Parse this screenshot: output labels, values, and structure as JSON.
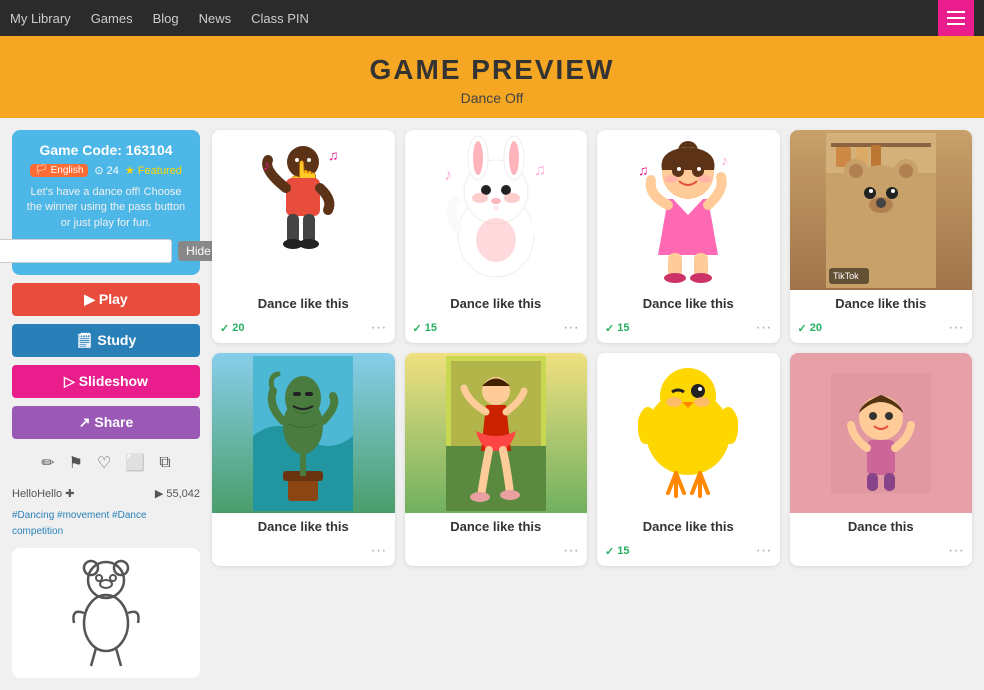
{
  "nav": {
    "items": [
      "My Library",
      "Games",
      "Blog",
      "News",
      "Class PIN"
    ]
  },
  "header": {
    "title": "Game Preview",
    "subtitle": "Dance Off"
  },
  "sidebar": {
    "game_code_label": "Game Code: 163104",
    "badge_english": "🏳 English",
    "badge_count": "⊙ 24",
    "badge_featured": "★ Featured",
    "description": "Let's have a dance off! Choose the winner using the pass button or just play for fun.",
    "hide_placeholder": "",
    "hide_btn": "Hide",
    "play_btn": "▶ Play",
    "study_btn": "🗒 Study",
    "slideshow_btn": "▷ Slideshow",
    "share_btn": "↗ Share",
    "author": "HelloHello ✚",
    "play_count": "55,042",
    "tags": "#Dancing #movement #Dance competition",
    "tools": [
      "✏",
      "⚑",
      "♡",
      "⬜",
      "⧉"
    ]
  },
  "cards": [
    {
      "id": 1,
      "label": "Dance like this",
      "votes": 20,
      "type": "hand-dance"
    },
    {
      "id": 2,
      "label": "Dance like this",
      "votes": 15,
      "type": "bunny"
    },
    {
      "id": 3,
      "label": "Dance like this",
      "votes": 15,
      "type": "baby-girl"
    },
    {
      "id": 4,
      "label": "Dance like this",
      "votes": 20,
      "type": "bear-photo",
      "watermark": "TikTok"
    },
    {
      "id": 5,
      "label": "Dance like this",
      "votes": null,
      "type": "groot"
    },
    {
      "id": 6,
      "label": "Dance like this",
      "votes": null,
      "type": "ballerina"
    },
    {
      "id": 7,
      "label": "Dance like this",
      "votes": 15,
      "type": "chick"
    },
    {
      "id": 8,
      "label": "Dance this",
      "votes": null,
      "type": "child-photo"
    }
  ],
  "colors": {
    "accent": "#e91e8c",
    "play": "#e74c3c",
    "study": "#2980b9",
    "share": "#9b59b6",
    "gamecode": "#4db8e8",
    "votes": "#27ae60"
  }
}
